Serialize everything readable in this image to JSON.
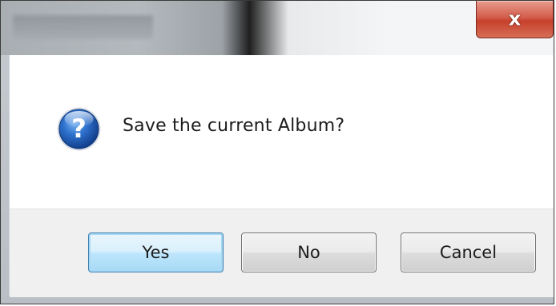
{
  "window": {
    "title": "",
    "close_glyph": "x"
  },
  "dialog": {
    "icon": "question-icon",
    "message": "Save the current Album?"
  },
  "buttons": {
    "yes_label": "Yes",
    "no_label": "No",
    "cancel_label": "Cancel",
    "default": "Yes"
  },
  "colors": {
    "close_button": "#c7402c",
    "icon_blue": "#1c5fb4",
    "default_button_border": "#3c7fb1"
  }
}
